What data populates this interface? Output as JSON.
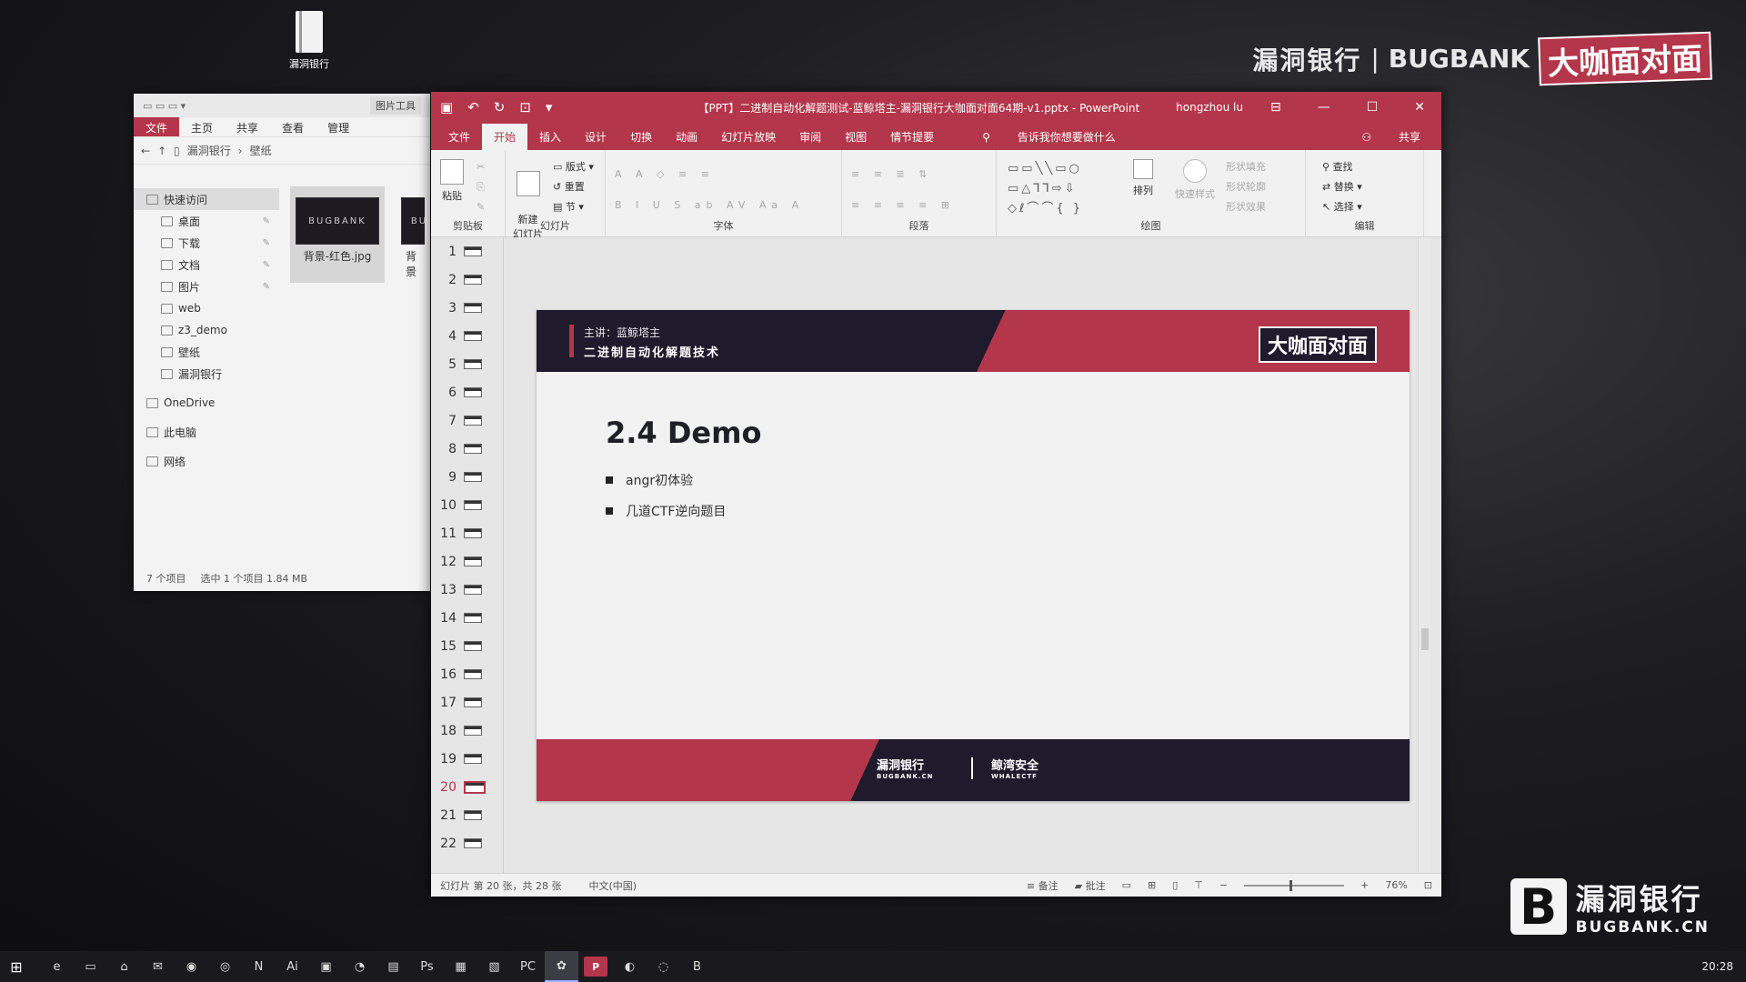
{
  "desktop": {
    "icon_label": "漏洞银行",
    "brand_top": {
      "cn": "漏洞银行",
      "sep": "|",
      "en": "BUGBANK",
      "logo": "大咖面对面"
    },
    "brand_bottom": {
      "mark": "B",
      "cn": "漏洞银行",
      "en": "BUGBANK.CN"
    }
  },
  "explorer": {
    "title_context": "图片工具",
    "tabs": [
      "文件",
      "主页",
      "共享",
      "查看",
      "管理"
    ],
    "address": {
      "path1": "漏洞银行",
      "sep": "›",
      "path2": "壁纸"
    },
    "nav": [
      {
        "label": "快速访问",
        "top": true,
        "active": true
      },
      {
        "label": "桌面",
        "pin": true
      },
      {
        "label": "下载",
        "pin": true
      },
      {
        "label": "文档",
        "pin": true
      },
      {
        "label": "图片",
        "pin": true
      },
      {
        "label": "web"
      },
      {
        "label": "z3_demo"
      },
      {
        "label": "壁纸"
      },
      {
        "label": "漏洞银行"
      },
      {
        "label": "OneDrive",
        "top": true
      },
      {
        "label": "此电脑",
        "top": true
      },
      {
        "label": "网络",
        "top": true
      }
    ],
    "files": [
      {
        "name": "背景-红色.jpg",
        "thumb_text": "BUGBANK"
      },
      {
        "name": "背景",
        "thumb_text": "BU"
      }
    ],
    "status": {
      "count": "7 个项目",
      "selected": "选中 1 个项目  1.84 MB"
    }
  },
  "ppt": {
    "window_title": "【PPT】二进制自动化解题测试-蓝鲸塔主-漏洞银行大咖面对面64期-v1.pptx - PowerPoint",
    "user": "hongzhou lu",
    "tabs": [
      "文件",
      "开始",
      "插入",
      "设计",
      "切换",
      "动画",
      "幻灯片放映",
      "审阅",
      "视图",
      "情节提要"
    ],
    "active_tab": "开始",
    "tell_me": "告诉我你想要做什么",
    "share": "共享",
    "ribbon": {
      "clipboard": {
        "paste": "粘贴",
        "label": "剪贴板"
      },
      "slides": {
        "new_slide": "新建\n幻灯片",
        "layout": "版式",
        "reset": "重置",
        "section": "节",
        "label": "幻灯片"
      },
      "font": {
        "label": "字体"
      },
      "paragraph": {
        "label": "段落"
      },
      "drawing": {
        "arrange": "排列",
        "quick_styles": "快速样式",
        "fill": "形状填充",
        "outline": "形状轮廓",
        "effects": "形状效果",
        "label": "绘图"
      },
      "editing": {
        "find": "查找",
        "replace": "替换",
        "select": "选择",
        "label": "编辑"
      }
    },
    "thumbs": [
      1,
      2,
      3,
      4,
      5,
      6,
      7,
      8,
      9,
      10,
      11,
      12,
      13,
      14,
      15,
      16,
      17,
      18,
      19,
      20,
      21,
      22
    ],
    "active_slide": 20,
    "slide": {
      "banner_line1": "主讲：蓝鲸塔主",
      "banner_line2": "二进制自动化解题技术",
      "banner_badge": "大咖面对面",
      "title": "2.4 Demo",
      "bullets": [
        "angr初体验",
        "几道CTF逆向题目"
      ],
      "footer_logo1": "漏洞银行",
      "footer_logo1_sub": "BUGBANK.CN",
      "footer_logo2": "鲸湾安全",
      "footer_logo2_sub": "WHALECTF"
    },
    "status": {
      "slide_info": "幻灯片 第 20 张，共 28 张",
      "language": "中文(中国)",
      "notes": "备注",
      "comments": "批注",
      "zoom": "76%"
    }
  },
  "taskbar": {
    "apps": [
      "e",
      "▭",
      "⌂",
      "✉",
      "◉",
      "◎",
      "N",
      "Ai",
      "▣",
      "◔",
      "▤",
      "Ps",
      "▦",
      "▧",
      "PC",
      "✿",
      "P",
      "◐",
      "◌",
      "B"
    ],
    "active_index": 15,
    "clock": "20:28"
  },
  "colors": {
    "accent": "#b3364a",
    "dark": "#1f1a2c"
  }
}
